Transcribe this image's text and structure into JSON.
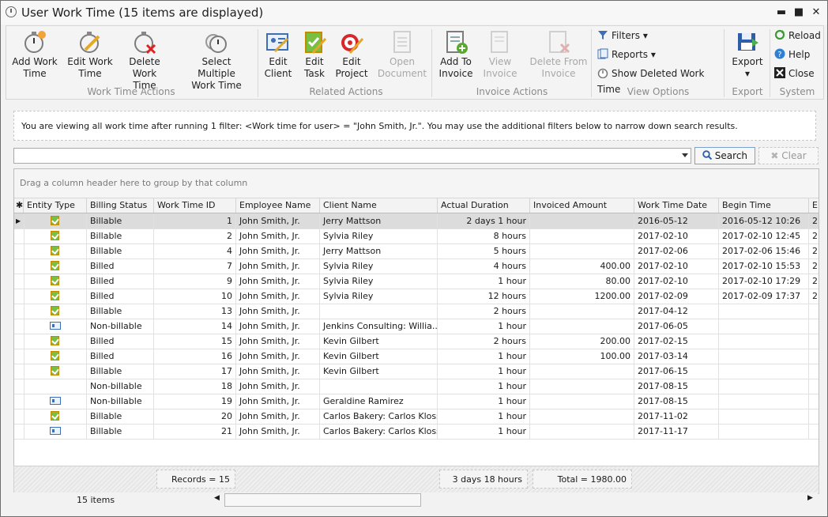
{
  "window": {
    "title": "User Work Time (15 items are displayed)",
    "minimize": "▬",
    "maximize": "■",
    "close": "✕"
  },
  "ribbon": {
    "groups": [
      {
        "label": "Work Time Actions"
      },
      {
        "label": "Related Actions"
      },
      {
        "label": "Invoice Actions"
      },
      {
        "label": "View Options"
      },
      {
        "label": "Export"
      },
      {
        "label": "System"
      }
    ],
    "add_work_time": "Add Work\nTime",
    "edit_work_time": "Edit Work\nTime",
    "delete_work_time": "Delete\nWork Time",
    "select_multiple": "Select Multiple\nWork Time",
    "edit_client": "Edit\nClient",
    "edit_task": "Edit\nTask",
    "edit_project": "Edit\nProject",
    "open_document": "Open\nDocument",
    "add_to_invoice": "Add To\nInvoice",
    "view_invoice": "View\nInvoice",
    "delete_from_invoice": "Delete From\nInvoice",
    "filters": "Filters",
    "reports": "Reports",
    "show_deleted": "Show Deleted Work Time",
    "export": "Export",
    "reload": "Reload",
    "help": "Help",
    "close": "Close"
  },
  "info_text": "You are viewing all work time after running 1 filter: <Work time for user> = \"John Smith, Jr.\". You may use the additional filters below to narrow down search results.",
  "search": {
    "value": "",
    "button": "Search",
    "clear": "Clear"
  },
  "grid": {
    "group_hint": "Drag a column header here to group by that column",
    "columns": [
      "Entity Type",
      "Billing Status",
      "Work Time ID",
      "Employee Name",
      "Client Name",
      "Actual Duration",
      "Invoiced Amount",
      "Work Time Date",
      "Begin Time",
      "E"
    ],
    "rows": [
      {
        "icon": "billable",
        "status": "Billable",
        "id": "1",
        "emp": "John Smith, Jr.",
        "client": "Jerry Mattson",
        "dur": "2 days 1 hour",
        "amt": "",
        "date": "2016-05-12",
        "begin": "2016-05-12 10:26",
        "e": "2"
      },
      {
        "icon": "billable",
        "status": "Billable",
        "id": "2",
        "emp": "John Smith, Jr.",
        "client": "Sylvia Riley",
        "dur": "8 hours",
        "amt": "",
        "date": "2017-02-10",
        "begin": "2017-02-10 12:45",
        "e": "2"
      },
      {
        "icon": "billable",
        "status": "Billable",
        "id": "4",
        "emp": "John Smith, Jr.",
        "client": "Jerry Mattson",
        "dur": "5 hours",
        "amt": "",
        "date": "2017-02-06",
        "begin": "2017-02-06 15:46",
        "e": "2"
      },
      {
        "icon": "billable",
        "status": "Billed",
        "id": "7",
        "emp": "John Smith, Jr.",
        "client": "Sylvia Riley",
        "dur": "4 hours",
        "amt": "400.00",
        "date": "2017-02-10",
        "begin": "2017-02-10 15:53",
        "e": "2"
      },
      {
        "icon": "billable",
        "status": "Billed",
        "id": "9",
        "emp": "John Smith, Jr.",
        "client": "Sylvia Riley",
        "dur": "1 hour",
        "amt": "80.00",
        "date": "2017-02-10",
        "begin": "2017-02-10 17:29",
        "e": "2"
      },
      {
        "icon": "billable",
        "status": "Billed",
        "id": "10",
        "emp": "John Smith, Jr.",
        "client": "Sylvia Riley",
        "dur": "12 hours",
        "amt": "1200.00",
        "date": "2017-02-09",
        "begin": "2017-02-09 17:37",
        "e": "2"
      },
      {
        "icon": "billable",
        "status": "Billable",
        "id": "13",
        "emp": "John Smith, Jr.",
        "client": "",
        "dur": "2 hours",
        "amt": "",
        "date": "2017-04-12",
        "begin": "",
        "e": ""
      },
      {
        "icon": "card",
        "status": "Non-billable",
        "id": "14",
        "emp": "John Smith, Jr.",
        "client": "Jenkins Consulting: Willia...",
        "dur": "1 hour",
        "amt": "",
        "date": "2017-06-05",
        "begin": "",
        "e": ""
      },
      {
        "icon": "billable",
        "status": "Billed",
        "id": "15",
        "emp": "John Smith, Jr.",
        "client": "Kevin Gilbert",
        "dur": "2 hours",
        "amt": "200.00",
        "date": "2017-02-15",
        "begin": "",
        "e": ""
      },
      {
        "icon": "billable",
        "status": "Billed",
        "id": "16",
        "emp": "John Smith, Jr.",
        "client": "Kevin Gilbert",
        "dur": "1 hour",
        "amt": "100.00",
        "date": "2017-03-14",
        "begin": "",
        "e": ""
      },
      {
        "icon": "billable",
        "status": "Billable",
        "id": "17",
        "emp": "John Smith, Jr.",
        "client": "Kevin Gilbert",
        "dur": "1 hour",
        "amt": "",
        "date": "2017-06-15",
        "begin": "",
        "e": ""
      },
      {
        "icon": "",
        "status": "Non-billable",
        "id": "18",
        "emp": "John Smith, Jr.",
        "client": "",
        "dur": "1 hour",
        "amt": "",
        "date": "2017-08-15",
        "begin": "",
        "e": ""
      },
      {
        "icon": "card",
        "status": "Non-billable",
        "id": "19",
        "emp": "John Smith, Jr.",
        "client": "Geraldine Ramirez",
        "dur": "1 hour",
        "amt": "",
        "date": "2017-08-15",
        "begin": "",
        "e": ""
      },
      {
        "icon": "billable",
        "status": "Billable",
        "id": "20",
        "emp": "John Smith, Jr.",
        "client": "Carlos Bakery: Carlos Kloss",
        "dur": "1 hour",
        "amt": "",
        "date": "2017-11-02",
        "begin": "",
        "e": ""
      },
      {
        "icon": "card",
        "status": "Billable",
        "id": "21",
        "emp": "John Smith, Jr.",
        "client": "Carlos Bakery: Carlos Kloss",
        "dur": "1 hour",
        "amt": "",
        "date": "2017-11-17",
        "begin": "",
        "e": ""
      }
    ]
  },
  "summary": {
    "records": "Records = 15",
    "duration": "3 days 18 hours",
    "total": "Total = 1980.00"
  },
  "status": {
    "items": "15 items"
  }
}
